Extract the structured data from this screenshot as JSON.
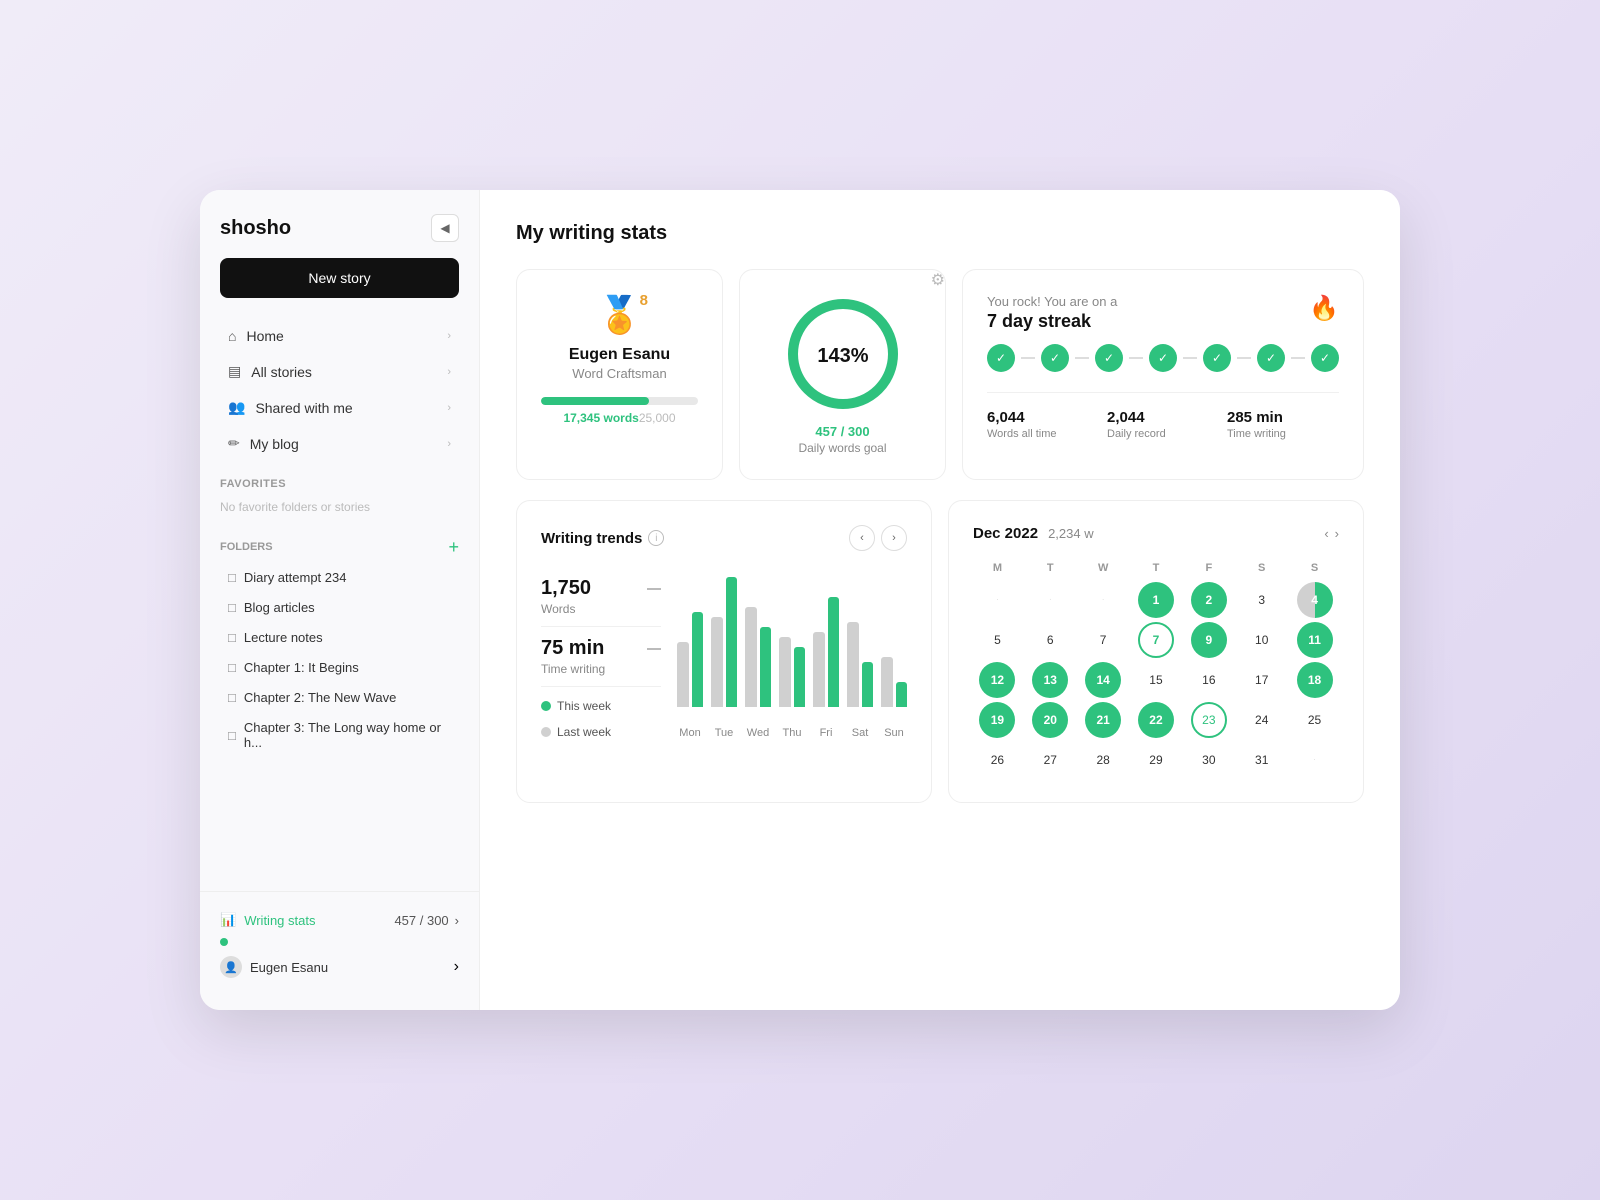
{
  "app": {
    "name": "shosho"
  },
  "sidebar": {
    "new_story_label": "New story",
    "collapse_icon": "◀",
    "nav_items": [
      {
        "id": "home",
        "icon": "⌂",
        "label": "Home"
      },
      {
        "id": "all-stories",
        "icon": "▤",
        "label": "All stories"
      },
      {
        "id": "shared-with-me",
        "icon": "👥",
        "label": "Shared with me"
      },
      {
        "id": "my-blog",
        "icon": "✏",
        "label": "My blog"
      }
    ],
    "favorites_label": "Favorites",
    "no_favorites_text": "No favorite folders or stories",
    "folders_label": "Folders",
    "add_folder_icon": "+",
    "folders": [
      {
        "id": "diary",
        "label": "Diary attempt 234"
      },
      {
        "id": "blog",
        "label": "Blog articles"
      },
      {
        "id": "lecture",
        "label": "Lecture notes"
      },
      {
        "id": "chapter1",
        "label": "Chapter 1: It Begins"
      },
      {
        "id": "chapter2",
        "label": "Chapter 2: The New Wave"
      },
      {
        "id": "chapter3",
        "label": "Chapter 3: The Long way home or h..."
      }
    ],
    "writing_stats_label": "Writing stats",
    "writing_stats_progress": "457 / 300",
    "user_name": "Eugen Esanu",
    "chevron": "›"
  },
  "main": {
    "page_title": "My writing stats",
    "profile_card": {
      "badge_level": "8",
      "badge_icon": "🏅",
      "user_name": "Eugen Esanu",
      "user_title": "Word Craftsman",
      "words_current": "17,345 words",
      "words_goal": "25,000",
      "progress_percent": 69
    },
    "circle_card": {
      "percentage": "143%",
      "words_current": "457",
      "words_goal": "300",
      "goal_label": "Daily words goal",
      "gear_icon": "⚙"
    },
    "streak_card": {
      "subtitle": "You rock! You are on a",
      "title": "7 day streak",
      "fire_icon": "🔥",
      "streak_days": 7,
      "stats": [
        {
          "value": "6,044",
          "label": "Words all time"
        },
        {
          "value": "2,044",
          "label": "Daily record"
        },
        {
          "value": "285 min",
          "label": "Time writing"
        }
      ]
    },
    "writing_trends": {
      "title": "Writing trends",
      "info_icon": "i",
      "metrics": [
        {
          "value": "1,750",
          "label": "Words"
        },
        {
          "value": "75 min",
          "label": "Time writing"
        }
      ],
      "legend": [
        {
          "label": "This week",
          "color": "green"
        },
        {
          "label": "Last week",
          "color": "gray"
        }
      ],
      "days": [
        "Mon",
        "Tue",
        "Wed",
        "Thu",
        "Fri",
        "Sat",
        "Sun"
      ],
      "this_week_heights": [
        95,
        130,
        80,
        60,
        110,
        45,
        25
      ],
      "last_week_heights": [
        65,
        90,
        100,
        70,
        75,
        85,
        50
      ]
    },
    "calendar": {
      "month": "Dec 2022",
      "words": "2,234 w",
      "day_headers": [
        "M",
        "T",
        "W",
        "T",
        "F",
        "S",
        "S"
      ],
      "weeks": [
        [
          {
            "label": "·",
            "type": "dot-only"
          },
          {
            "label": "·",
            "type": "dot-only"
          },
          {
            "label": "·",
            "type": "dot-only"
          },
          {
            "label": "1",
            "type": "filled"
          },
          {
            "label": "2",
            "type": "filled"
          },
          {
            "label": "3",
            "type": "normal"
          },
          {
            "label": "4",
            "type": "partial"
          }
        ],
        [
          {
            "label": "5",
            "type": "normal"
          },
          {
            "label": "6",
            "type": "normal"
          },
          {
            "label": "7",
            "type": "normal"
          },
          {
            "label": "7",
            "type": "outlined"
          },
          {
            "label": "9",
            "type": "filled"
          },
          {
            "label": "10",
            "type": "normal"
          },
          {
            "label": "11",
            "type": "filled"
          }
        ],
        [
          {
            "label": "12",
            "type": "filled"
          },
          {
            "label": "13",
            "type": "filled"
          },
          {
            "label": "14",
            "type": "filled"
          },
          {
            "label": "15",
            "type": "normal"
          },
          {
            "label": "16",
            "type": "normal"
          },
          {
            "label": "17",
            "type": "normal"
          },
          {
            "label": "18",
            "type": "filled"
          }
        ],
        [
          {
            "label": "19",
            "type": "filled"
          },
          {
            "label": "20",
            "type": "filled"
          },
          {
            "label": "21",
            "type": "filled"
          },
          {
            "label": "22",
            "type": "filled"
          },
          {
            "label": "23",
            "type": "today-outlined"
          },
          {
            "label": "24",
            "type": "normal"
          },
          {
            "label": "25",
            "type": "normal"
          }
        ],
        [
          {
            "label": "26",
            "type": "normal"
          },
          {
            "label": "27",
            "type": "normal"
          },
          {
            "label": "28",
            "type": "normal"
          },
          {
            "label": "29",
            "type": "normal"
          },
          {
            "label": "30",
            "type": "normal"
          },
          {
            "label": "31",
            "type": "normal"
          },
          {
            "label": "·",
            "type": "dot-only"
          }
        ]
      ]
    }
  }
}
